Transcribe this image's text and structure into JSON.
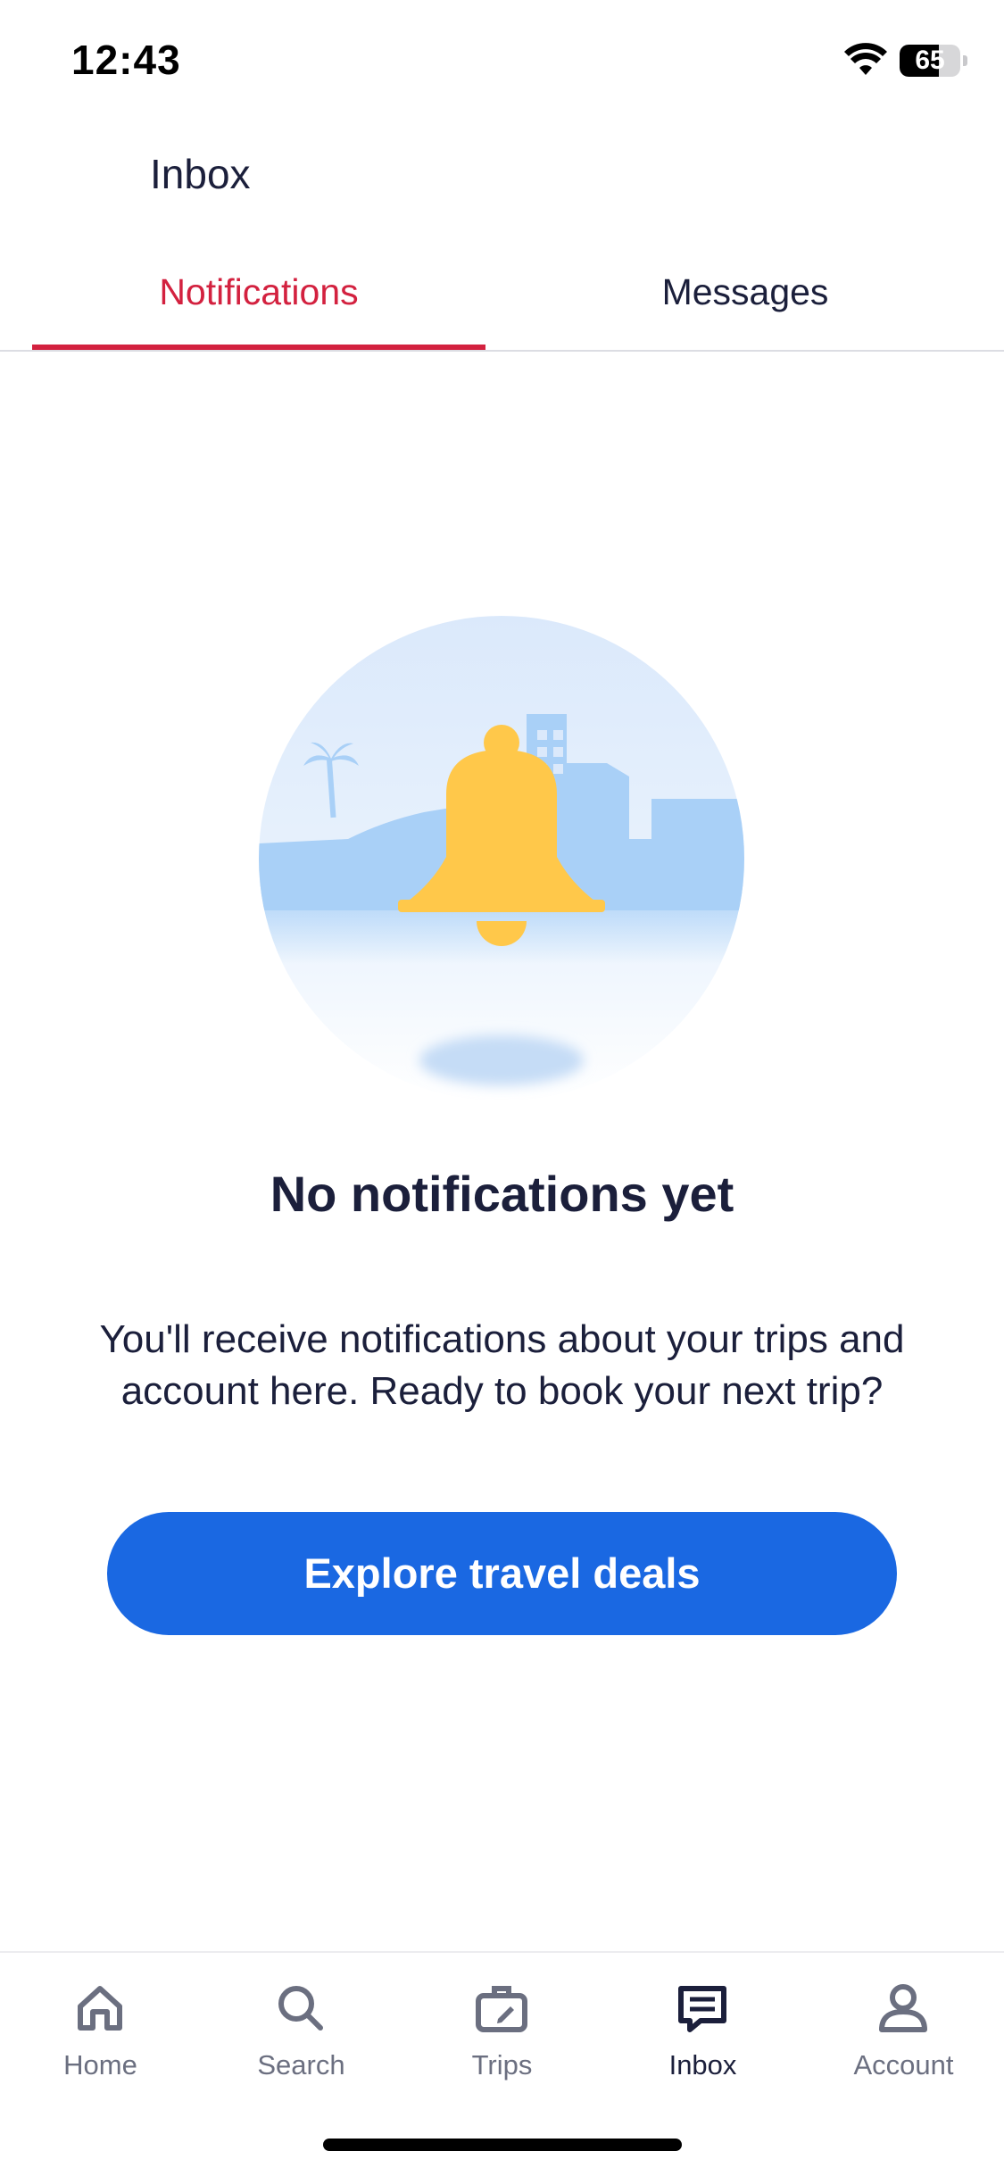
{
  "status_bar": {
    "time": "12:43",
    "battery_level": "65",
    "battery_fraction": 0.65
  },
  "header": {
    "title": "Inbox"
  },
  "tabs": [
    {
      "label": "Notifications",
      "active": true
    },
    {
      "label": "Messages",
      "active": false
    }
  ],
  "empty_state": {
    "illustration_icon": "bell-icon",
    "title": "No notifications yet",
    "body": "You'll receive notifications about your trips and account here. Ready to book your next trip?",
    "cta_label": "Explore travel deals"
  },
  "bottom_nav": {
    "items": [
      {
        "label": "Home",
        "icon": "home-icon"
      },
      {
        "label": "Search",
        "icon": "search-icon"
      },
      {
        "label": "Trips",
        "icon": "suitcase-icon"
      },
      {
        "label": "Inbox",
        "icon": "inbox-icon",
        "active": true
      },
      {
        "label": "Account",
        "icon": "account-icon"
      }
    ]
  },
  "colors": {
    "accent_red": "#d3213f",
    "primary_blue": "#1a68e2",
    "text_dark": "#1b1f3b",
    "text_muted": "#6b6f80",
    "bell_yellow": "#ffc84a",
    "scene_blue": "#a9d0f7"
  }
}
